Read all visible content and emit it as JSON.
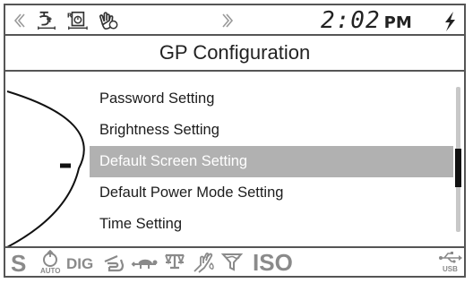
{
  "status_bar": {
    "time": "2:02",
    "ampm": "PM",
    "icons": [
      "prev-page-arrow",
      "hand-touch-icon",
      "scale-timer-icon",
      "tap-icon",
      "next-page-arrow",
      "lightning-bolt-icon"
    ]
  },
  "title": "GP Configuration",
  "menu": {
    "items": [
      {
        "label": "Password Setting"
      },
      {
        "label": "Brightness Setting"
      },
      {
        "label": "Default Screen Setting"
      },
      {
        "label": "Default Power Mode Setting"
      },
      {
        "label": "Time Setting"
      }
    ],
    "selected_index": 2
  },
  "dial": {
    "marker": "-"
  },
  "bottom_bar": {
    "s_label": "S",
    "auto_label": "AUTO",
    "dig_label": "DIG",
    "iso_label": "ISO",
    "usb_label": "USB",
    "icons": [
      "auto-icon",
      "pointing-hand-icon",
      "turtle-icon",
      "scale-icon",
      "hand-water-icon",
      "filter-icon",
      "usb-icon"
    ]
  },
  "colors": {
    "selection_bg": "#b1b1b1",
    "bottom_icons": "#8a8a8a",
    "border": "#555555"
  }
}
